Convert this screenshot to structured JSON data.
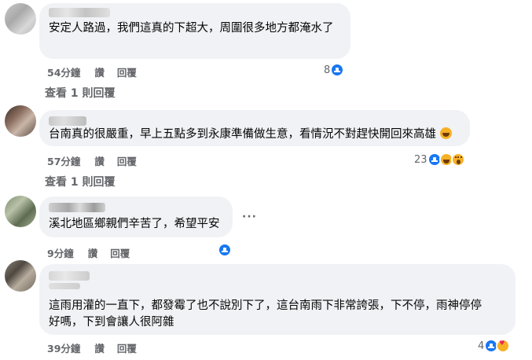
{
  "comments": [
    {
      "text": "安定人路過，我們這真的下超大，周圍很多地方都淹水了",
      "time": "54分鐘",
      "like_label": "讚",
      "reply_label": "回覆",
      "reaction_count": "8",
      "reactions": [
        "like-icon"
      ],
      "view_replies": "查看 1 則回覆"
    },
    {
      "text": "台南真的很嚴重，早上五點多到永康準備做生意，看情況不對趕快開回來高雄",
      "time": "57分鐘",
      "like_label": "讚",
      "reply_label": "回覆",
      "reaction_count": "23",
      "reactions": [
        "like-icon",
        "haha-icon",
        "wow-icon"
      ],
      "view_replies": "查看 1 則回覆"
    },
    {
      "text": "溪北地區鄉親們辛苦了，希望平安",
      "time": "9分鐘",
      "like_label": "讚",
      "reply_label": "回覆",
      "reaction_count": "",
      "reactions": [
        "like-icon"
      ],
      "more_label": "···"
    },
    {
      "text_line1": "這雨用灌的一直下，都發霉了也不說別下了，這台南雨下非常誇張，下不停，雨神停停",
      "text_line2": "好嗎，下到會讓人很阿雜",
      "time": "39分鐘",
      "like_label": "讚",
      "reply_label": "回覆",
      "reaction_count": "4",
      "reactions": [
        "like-icon",
        "heart-face-icon"
      ]
    }
  ],
  "colors": {
    "bubble": "#f0f2f5",
    "meta_text": "#65676b",
    "like_blue": "#1877f2",
    "emoji_yellow": "#f7b125"
  }
}
